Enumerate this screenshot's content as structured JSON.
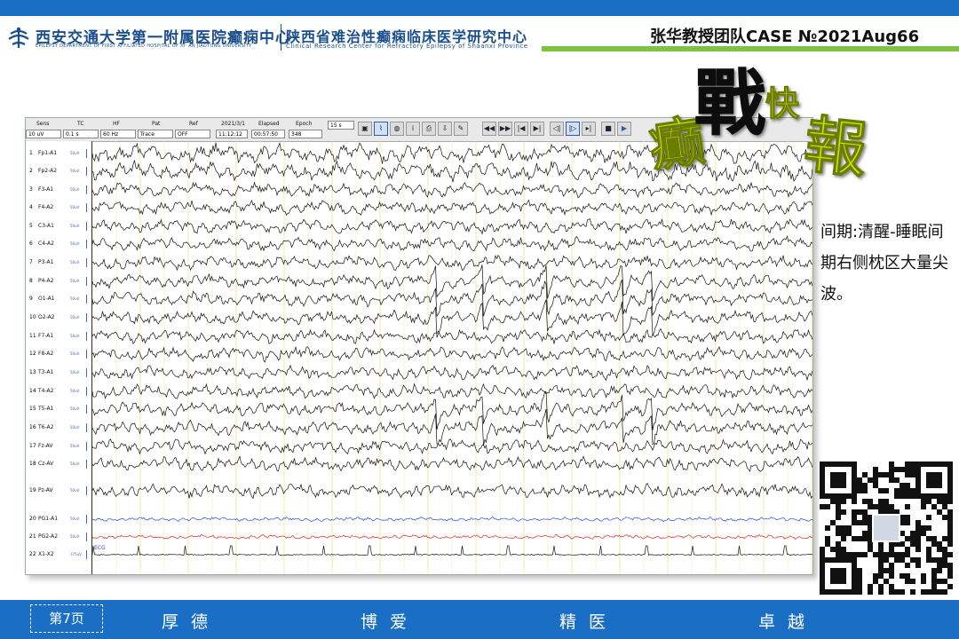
{
  "header": {
    "hospital_cn": "西安交通大学第一附属医院癫痫中心",
    "hospital_en": "EPILEPSY DEPARTMENT OF FIRST AFFILIATED HOSPITAL OF XI' AN JIAOTONG UNIVERSITY",
    "center_cn": "陕西省难治性癫痫临床医学研究中心",
    "center_en": "Clinical Research Center for Refractory Epilepsy of Shaanxi Province",
    "case_title": "张华教授团队CASE №2021Aug66"
  },
  "colors": {
    "brand_blue": "#1a6fc4",
    "accent_green": "#7dc242",
    "title_art_green": "#c8e000",
    "ekg_blue": "#2a4bd8",
    "ekg_red": "#d62828"
  },
  "toolbar": {
    "labels": {
      "sens": "Sens",
      "tc": "TC",
      "hf": "HF",
      "pat": "Pat",
      "ref": "Ref",
      "date": "2021/3/1",
      "elapsed": "Elapsed",
      "epoch": "Epoch"
    },
    "values": {
      "sens": "10 uV",
      "tc": "0.1 s",
      "hf": "60 Hz",
      "pat": "Trace",
      "ref": "OFF",
      "time": "11:12:12",
      "elapsed": "00:57:50",
      "epoch": "348",
      "page": "15 s"
    }
  },
  "channels": [
    {
      "num": "1",
      "name": "Fp1-A1",
      "scale": "50uV"
    },
    {
      "num": "2",
      "name": "Fp2-A2",
      "scale": "50uV"
    },
    {
      "num": "3",
      "name": "F3-A1",
      "scale": "50uV"
    },
    {
      "num": "4",
      "name": "F4-A2",
      "scale": "50uV"
    },
    {
      "num": "5",
      "name": "C3-A1",
      "scale": "50uV"
    },
    {
      "num": "6",
      "name": "C4-A2",
      "scale": "50uV"
    },
    {
      "num": "7",
      "name": "P3-A1",
      "scale": "50uV"
    },
    {
      "num": "8",
      "name": "P4-A2",
      "scale": "50uV"
    },
    {
      "num": "9",
      "name": "O1-A1",
      "scale": "50uV"
    },
    {
      "num": "10",
      "name": "O2-A2",
      "scale": "50uV"
    },
    {
      "num": "11",
      "name": "F7-A1",
      "scale": "50uV"
    },
    {
      "num": "12",
      "name": "F8-A2",
      "scale": "50uV"
    },
    {
      "num": "13",
      "name": "T3-A1",
      "scale": "50uV"
    },
    {
      "num": "14",
      "name": "T4-A2",
      "scale": "50uV"
    },
    {
      "num": "15",
      "name": "T5-A1",
      "scale": "50uV"
    },
    {
      "num": "16",
      "name": "T6-A2",
      "scale": "50uV"
    },
    {
      "num": "17",
      "name": "Fz-AV",
      "scale": "50uV"
    },
    {
      "num": "18",
      "name": "Cz-AV",
      "scale": "50uV"
    },
    {
      "num": "19",
      "name": "Pz-AV",
      "scale": "50uV"
    },
    {
      "num": "20",
      "name": "PG1-A1",
      "scale": "50uV"
    },
    {
      "num": "21",
      "name": "PG2-A2",
      "scale": "50uV"
    },
    {
      "num": "22",
      "name": "X1-X2",
      "scale": "375uV"
    }
  ],
  "ecg_label": "ECG",
  "title_art": {
    "chars": [
      "癫",
      "戰",
      "快",
      "報"
    ]
  },
  "description": "间期:清醒-睡眠间期右侧枕区大量尖波。",
  "footer": {
    "page": "第7页",
    "mottos": [
      "厚德",
      "博爱",
      "精医",
      "卓越"
    ]
  }
}
